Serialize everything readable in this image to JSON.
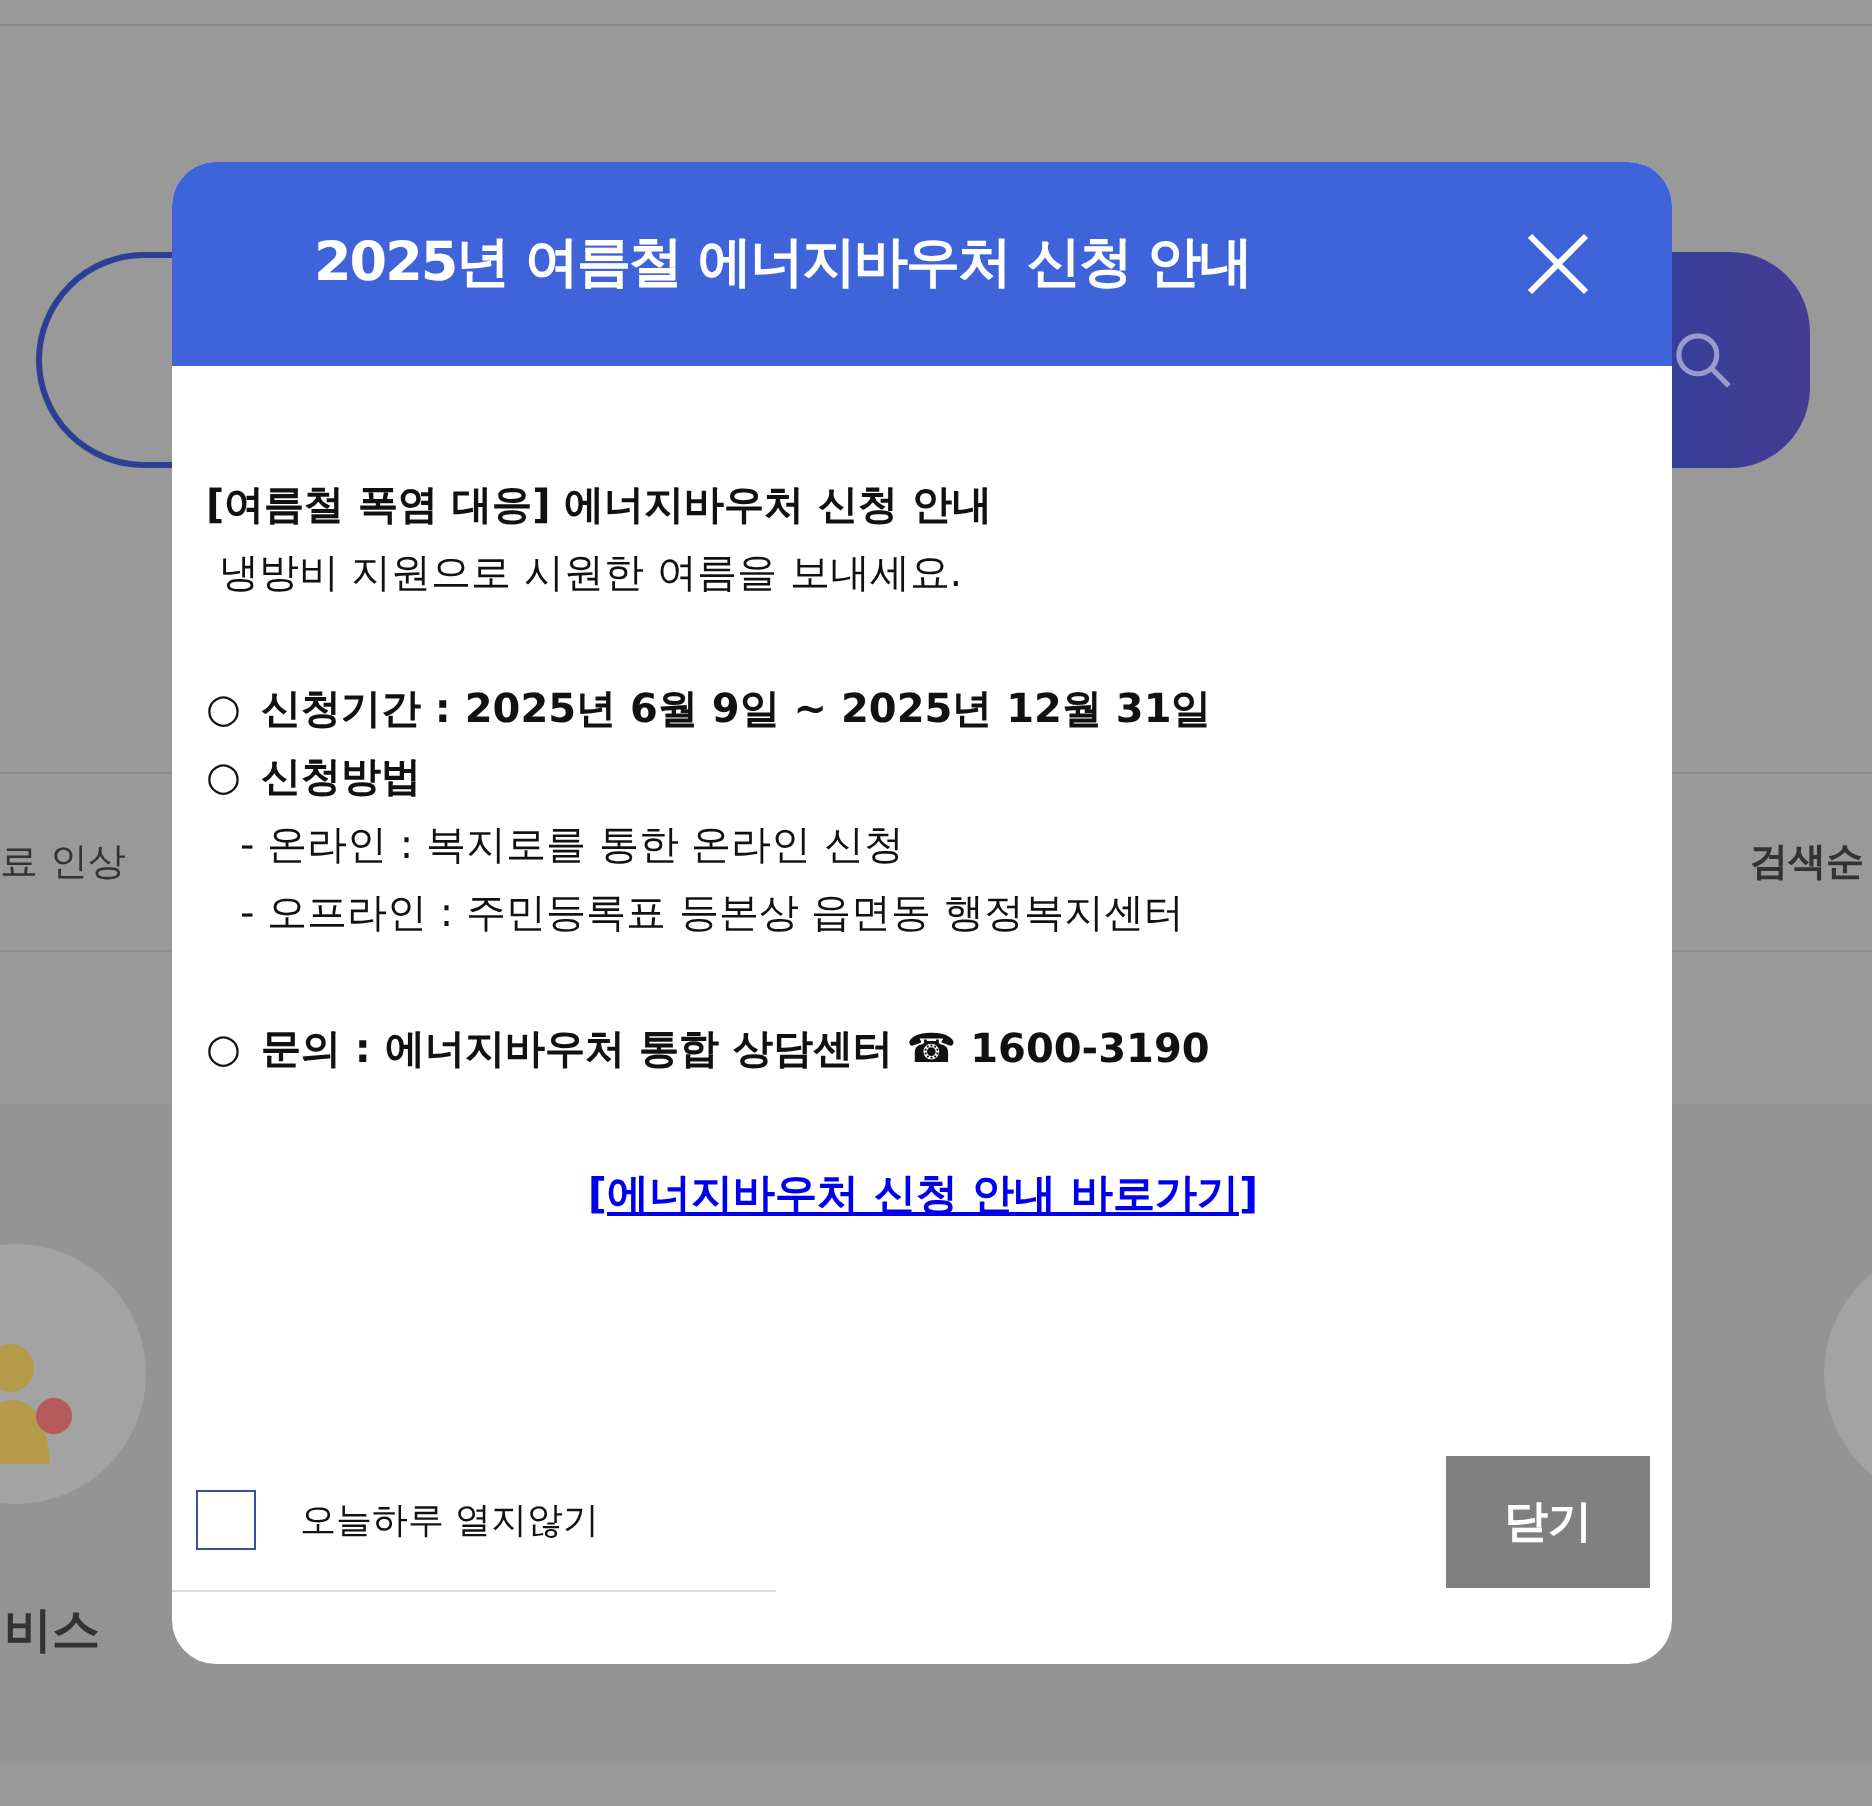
{
  "background": {
    "ticker_text": "료 인상",
    "ranking_label": "검색순",
    "service_label": "비스"
  },
  "modal": {
    "title": "2025년 여름철 에너지바우처 신청 안내",
    "sections": [
      {
        "lines": [
          {
            "kind": "heading",
            "text": "[여름철 폭염 대응] 에너지바우처 신청 안내"
          },
          {
            "kind": "text",
            "text": " 냉방비 지원으로 시원한 여름을 보내세요."
          }
        ]
      },
      {
        "lines": [
          {
            "kind": "bullet",
            "marker": "○",
            "text": "신청기간 : 2025년 6월 9일 ~ 2025년 12월 31일"
          },
          {
            "kind": "bullet",
            "marker": "○",
            "text": "신청방법"
          },
          {
            "kind": "sub",
            "text": "- 온라인 : 복지로를 통한 온라인 신청"
          },
          {
            "kind": "sub",
            "text": "- 오프라인 : 주민등록표 등본상 읍면동 행정복지센터"
          }
        ]
      },
      {
        "lines": [
          {
            "kind": "bullet",
            "marker": "○",
            "text": "문의 : 에너지바우처 통합 상담센터 ☎ 1600-3190"
          }
        ]
      }
    ],
    "link": {
      "open": "[",
      "text": "에너지바우처 신청 안내 바로가기",
      "close": "]"
    },
    "dont_show_today": {
      "label": "오늘하루 열지않기",
      "checked": false
    },
    "close_button": "닫기"
  }
}
